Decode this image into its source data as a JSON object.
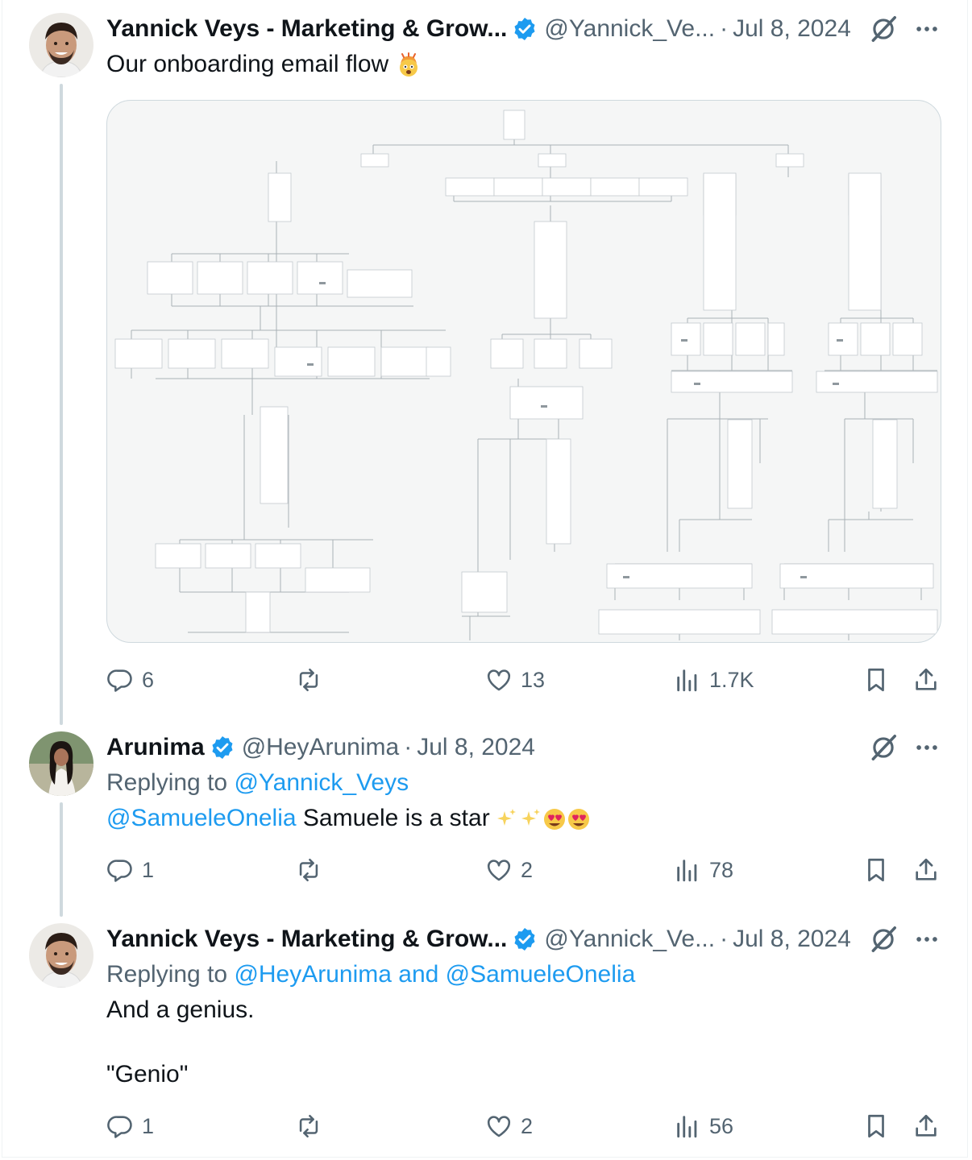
{
  "posts": [
    {
      "author_name": "Yannick Veys - Marketing & Grow...",
      "author_handle": "@Yannick_Ve...",
      "date": "Jul 8, 2024",
      "text": "Our onboarding email flow",
      "text_emoji": "exploding-head",
      "media": "onboarding-email-flow-diagram",
      "stats": {
        "replies": "6",
        "reposts": "",
        "likes": "13",
        "views": "1.7K"
      }
    },
    {
      "author_name": "Arunima",
      "author_handle": "@HeyArunima",
      "date": "Jul 8, 2024",
      "replying_prefix": "Replying to",
      "replying_to": "@Yannick_Veys",
      "mention": "@SamueleOnelia",
      "text": "Samuele is a star",
      "text_emoji": "sparkles-sparkles-heart-eyes-heart-eyes",
      "stats": {
        "replies": "1",
        "reposts": "",
        "likes": "2",
        "views": "78"
      }
    },
    {
      "author_name": "Yannick Veys - Marketing & Grow...",
      "author_handle": "@Yannick_Ve...",
      "date": "Jul 8, 2024",
      "replying_prefix": "Replying to",
      "replying_to": "@HeyArunima and @SamueleOnelia",
      "text_line1": "And a genius.",
      "text_line2": "\"Genio\"",
      "stats": {
        "replies": "1",
        "reposts": "",
        "likes": "2",
        "views": "56"
      }
    }
  ],
  "separator": "·",
  "colors": {
    "accent": "#1d9bf0",
    "muted": "#536471",
    "text": "#0f1419",
    "verified": "#1d9bf0",
    "thread_line": "#cfd9de"
  },
  "icons": [
    "verified-badge-icon",
    "grok-icon",
    "more-icon",
    "reply-icon",
    "repost-icon",
    "like-icon",
    "views-icon",
    "bookmark-icon",
    "share-icon"
  ]
}
